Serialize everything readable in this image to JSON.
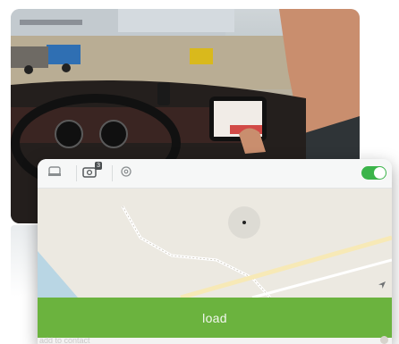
{
  "toolbar": {
    "icons": [
      "truck-icon",
      "camera-badge-icon",
      "gear-icon"
    ],
    "camera_badge_count": "3",
    "toggle_on": true
  },
  "main": {
    "load_label": "load"
  },
  "footer": {
    "status_text": "add to contact"
  },
  "colors": {
    "accent_green": "#6bb33e",
    "toggle_green": "#3bb44a",
    "map_background": "#ece9e1"
  }
}
